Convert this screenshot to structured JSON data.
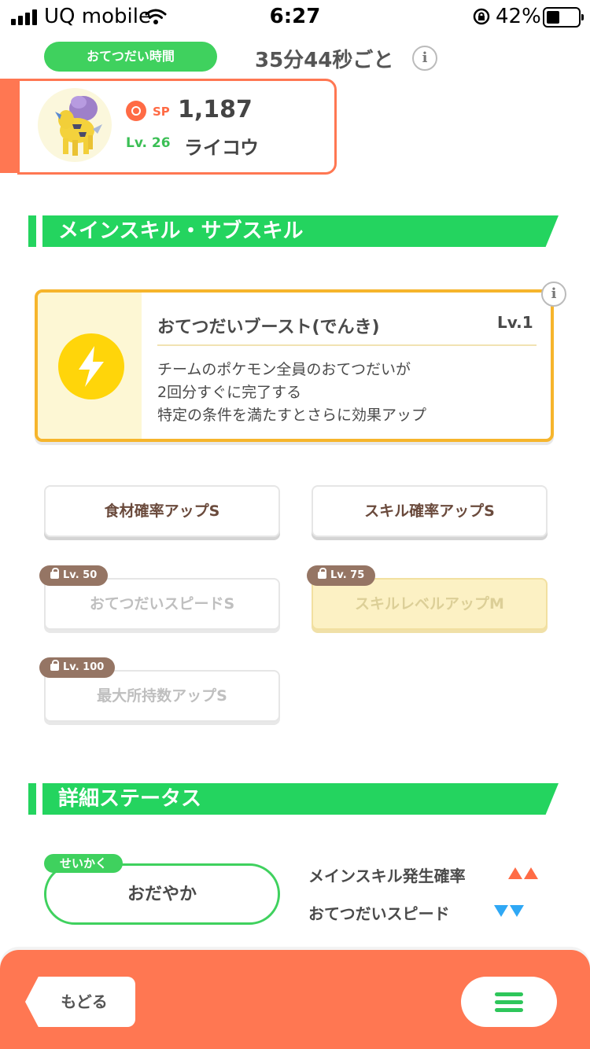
{
  "status_bar": {
    "carrier": "UQ mobile",
    "time": "6:27",
    "battery_percent": "42%"
  },
  "helper": {
    "label": "おてつだい時間",
    "value": "35分44秒ごと",
    "info_glyph": "i"
  },
  "pokemon": {
    "sp_label": "SP",
    "sp_value": "1,187",
    "level": "Lv. 26",
    "name": "ライコウ"
  },
  "skills_section": {
    "title": "メインスキル・サブスキル"
  },
  "main_skill": {
    "name": "おてつだいブースト(でんき)",
    "level": "Lv.1",
    "description": "チームのポケモン全員のおてつだいが\n2回分すぐに完了する\n特定の条件を満たすとさらに効果アップ",
    "icon": "lightning-bolt-icon",
    "info_glyph": "i"
  },
  "sub_skills": [
    {
      "label": "食材確率アップS",
      "lock": ""
    },
    {
      "label": "スキル確率アップS",
      "lock": ""
    },
    {
      "label": "おてつだいスピードS",
      "lock": "Lv. 50"
    },
    {
      "label": "スキルレベルアップM",
      "lock": "Lv. 75"
    },
    {
      "label": "最大所持数アップS",
      "lock": "Lv. 100"
    }
  ],
  "details_section": {
    "title": "詳細ステータス"
  },
  "nature": {
    "tag": "せいかく",
    "value": "おだやか",
    "effects": [
      {
        "label": "メインスキル発生確率",
        "direction": "up",
        "color": "#ff6b45"
      },
      {
        "label": "おてつだいスピード",
        "direction": "down",
        "color": "#2fa8f5"
      }
    ]
  },
  "footer": {
    "back_label": "もどる",
    "menu_icon": "hamburger-menu-icon"
  },
  "colors": {
    "accent_green": "#24d45f",
    "accent_orange": "#ff7752",
    "skill_border": "#f6b52c"
  }
}
